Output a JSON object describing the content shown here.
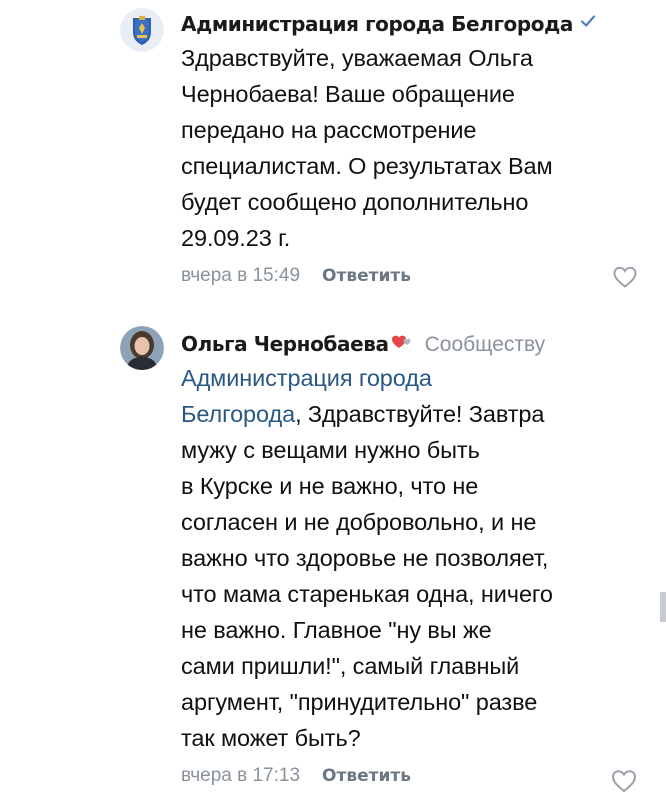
{
  "comments": [
    {
      "author": "Администрация города Белгорода",
      "verified": true,
      "text_lines": [
        "Здравствуйте, уважаемая Ольга",
        "Чернобаева! Ваше обращение",
        "передано на рассмотрение",
        "специалистам. О результатах Вам",
        "будет сообщено дополнительно",
        "29.09.23 г."
      ],
      "time": "вчера в 15:49",
      "reply_label": "Ответить"
    },
    {
      "author": "Ольга Чернобаева",
      "badge_icon": "heart-badge-icon",
      "to_label": "Сообществу",
      "mention_line1": "Администрация города",
      "mention_line2": "Белгорода",
      "text_first_tail": ", Здравствуйте! Завтра",
      "text_lines": [
        "мужу с вещами нужно быть",
        "в Курске и не важно, что не",
        "согласен и не добровольно, и не",
        "важно что здоровье не позволяет,",
        "что мама старенькая одна, ничего",
        "не важно. Главное \"ну вы же",
        "сами пришли!\", самый главный",
        "аргумент, \"принудительно\" разве",
        "так может быть?"
      ],
      "time": "вчера в 17:13",
      "reply_label": "Ответить"
    }
  ],
  "colors": {
    "link": "#2a5885",
    "secondary": "#8a929c",
    "verified": "#5181b8",
    "heart": "#e64646"
  },
  "icons": {
    "avatar1": "belgorod-coat-of-arms",
    "avatar2": "user-photo",
    "like": "heart-outline-icon",
    "verified": "checkmark-icon"
  }
}
